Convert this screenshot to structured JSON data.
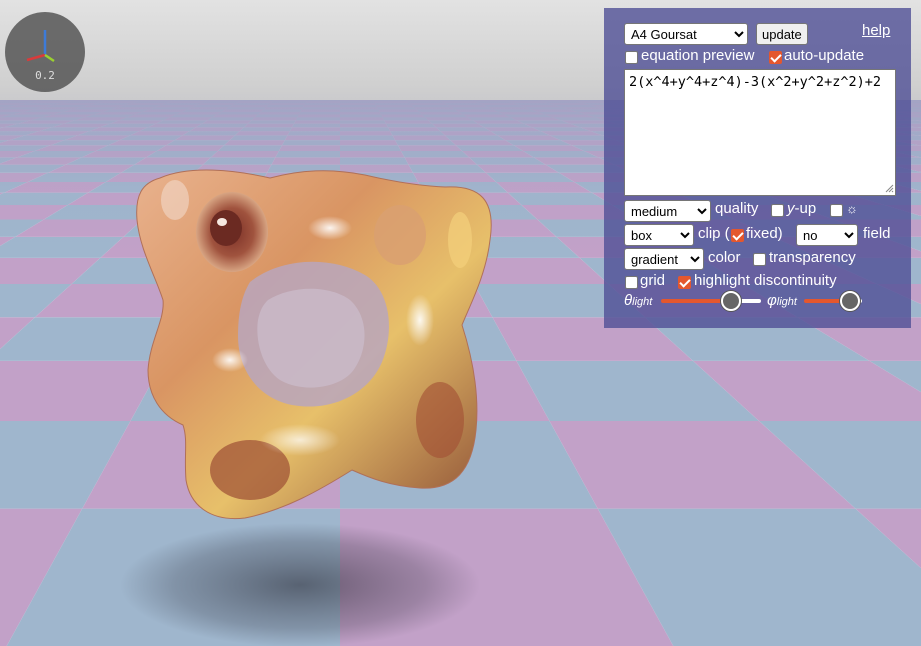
{
  "viewport": {
    "axis_gizmo": {
      "scale_label": "0.2"
    }
  },
  "panel": {
    "preset": {
      "selected": "A4 Goursat"
    },
    "update_label": "update",
    "help_label": "help",
    "equation_preview": {
      "label": "equation preview",
      "checked": false
    },
    "auto_update": {
      "label": "auto-update",
      "checked": true
    },
    "equation_text": "2(x^4+y^4+z^4)-3(x^2+y^2+z^2)+2",
    "quality": {
      "selected": "medium",
      "label": "quality"
    },
    "y_up": {
      "label_var": "y",
      "label_rest": "-up",
      "checked": false
    },
    "sun": {
      "label": "☼",
      "checked": false
    },
    "clip": {
      "selected": "box",
      "label_before": "clip (",
      "label_after": "fixed)",
      "fixed_checked": true
    },
    "field": {
      "selected": "no",
      "label": "field"
    },
    "color": {
      "selected": "gradient",
      "label": "color"
    },
    "transparency": {
      "label": "transparency",
      "checked": false
    },
    "grid": {
      "label": "grid",
      "checked": false
    },
    "highlight_discontinuity": {
      "label": "highlight discontinuity",
      "checked": true
    },
    "theta_light": {
      "symbol": "θ",
      "subscript": "light",
      "value_fraction": 0.7
    },
    "phi_light": {
      "symbol": "φ",
      "subscript": "light",
      "value_fraction": 0.8
    }
  },
  "colors": {
    "panel_bg": "#5050967f",
    "accent": "#e4572e",
    "floor_pink": "#c2a1c8",
    "floor_blue": "#9fb6cd"
  }
}
